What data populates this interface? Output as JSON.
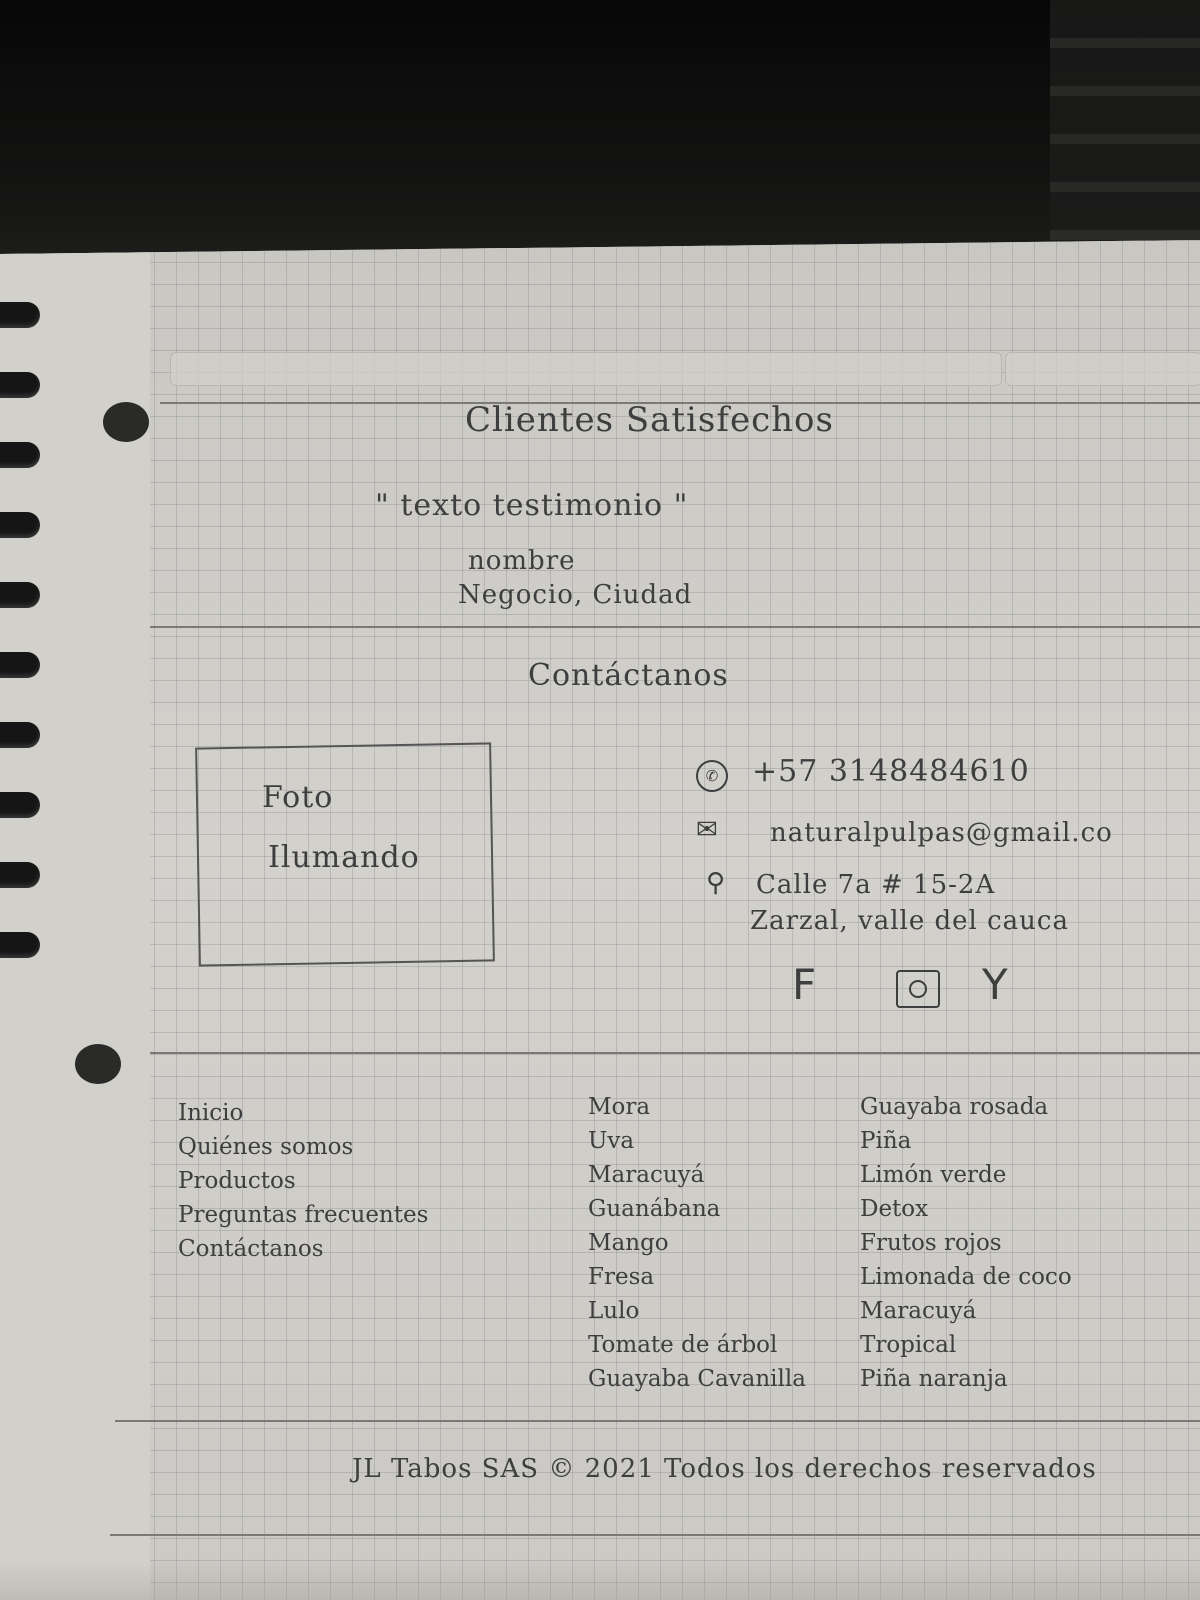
{
  "testimonials": {
    "title": "Clientes Satisfechos",
    "quote": "\" texto testimonio \"",
    "name": "nombre",
    "business": "Negocio, Ciudad"
  },
  "contact": {
    "title": "Contáctanos",
    "photo_label_1": "Foto",
    "photo_label_2": "Ilumando",
    "phone": "+57 3148484610",
    "email": "naturalpulpas@gmail.co",
    "address_1": "Calle 7a # 15-2A",
    "address_2": "Zarzal, valle del cauca",
    "social": {
      "facebook": "F",
      "youtube": "Y"
    }
  },
  "footer_links": {
    "nav": [
      "Inicio",
      "Quiénes somos",
      "Productos",
      "Preguntas frecuentes",
      "Contáctanos"
    ],
    "fruits": [
      "Mora",
      "Uva",
      "Maracuyá",
      "Guanábana",
      "Mango",
      "Fresa",
      "Lulo",
      "Tomate de árbol",
      "Guayaba Cavanilla"
    ],
    "combos": [
      "Guayaba rosada",
      "Piña",
      "Limón verde",
      "Detox",
      "Frutos rojos",
      "Limonada de coco",
      "Maracuyá",
      "Tropical",
      "Piña naranja"
    ]
  },
  "footer": {
    "copyright": "JL Tabos SAS © 2021 Todos los derechos reservados"
  }
}
